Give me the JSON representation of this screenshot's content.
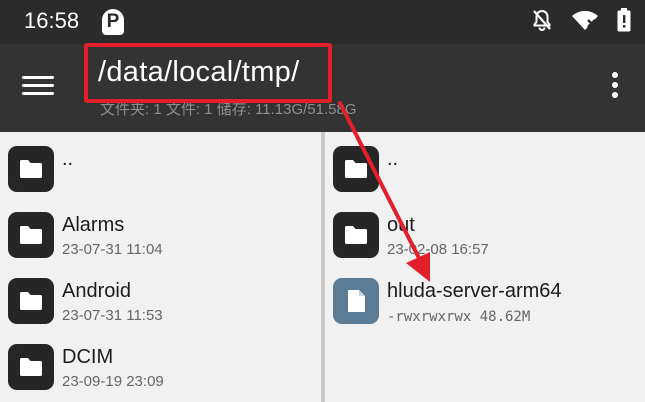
{
  "status_bar": {
    "time": "16:58",
    "app_icon_letter": "P",
    "icons": [
      "bell-off-icon",
      "wifi-x-icon",
      "battery-alert-icon"
    ]
  },
  "app_bar": {
    "path": "/data/local/tmp/",
    "summary": "文件夹: 1  文件: 1  储存: 11.13G/51.58G",
    "menu_icon": "hamburger-menu-icon",
    "overflow_icon": "more-vert-icon"
  },
  "left_pane": {
    "items": [
      {
        "name": "..",
        "meta": "",
        "type": "folder"
      },
      {
        "name": "Alarms",
        "meta": "23-07-31 11:04",
        "type": "folder"
      },
      {
        "name": "Android",
        "meta": "23-07-31 11:53",
        "type": "folder"
      },
      {
        "name": "DCIM",
        "meta": "23-09-19 23:09",
        "type": "folder"
      }
    ]
  },
  "right_pane": {
    "items": [
      {
        "name": "..",
        "meta": "",
        "type": "folder"
      },
      {
        "name": "out",
        "meta": "23-02-08 16:57",
        "type": "folder"
      },
      {
        "name": "hluda-server-arm64",
        "meta": "-rwxrwxrwx 48.62M",
        "type": "file"
      }
    ]
  },
  "annotation": {
    "color": "#e21f2b"
  }
}
